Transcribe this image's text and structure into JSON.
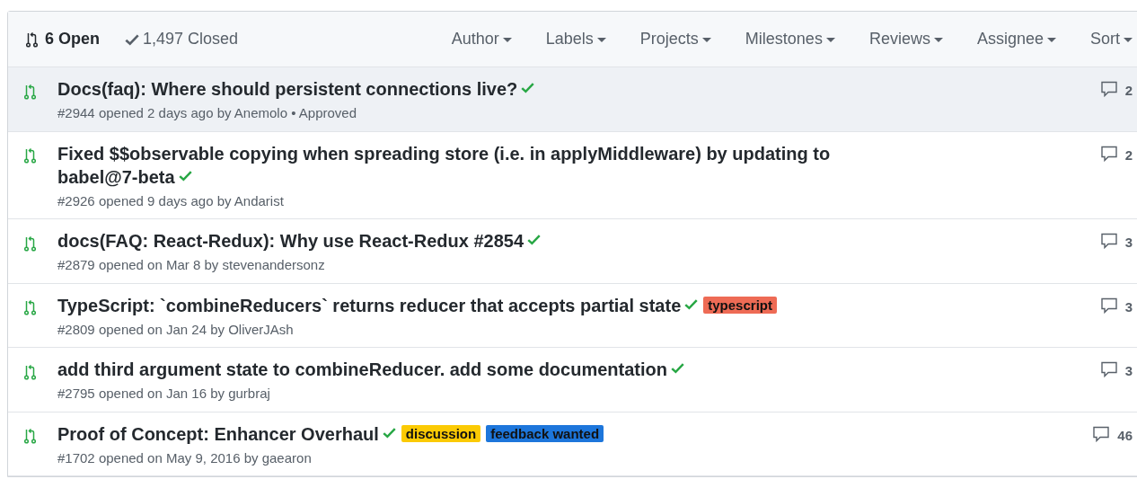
{
  "header": {
    "open": "6 Open",
    "closed": "1,497 Closed",
    "filters": [
      "Author",
      "Labels",
      "Projects",
      "Milestones",
      "Reviews",
      "Assignee",
      "Sort"
    ]
  },
  "pulls": [
    {
      "title": "Docs(faq): Where should persistent connections live?",
      "checks_passed": true,
      "selected": true,
      "meta": "#2944 opened 2 days ago by Anemolo • Approved",
      "comments": "2"
    },
    {
      "title": "Fixed $$observable copying when spreading store (i.e. in applyMiddleware) by updating to babel@7-beta",
      "checks_passed": true,
      "selected": false,
      "meta": "#2926 opened 9 days ago by Andarist",
      "comments": "2"
    },
    {
      "title": "docs(FAQ: React-Redux): Why use React-Redux #2854",
      "checks_passed": true,
      "selected": false,
      "meta": "#2879 opened on Mar 8 by stevenandersonz",
      "comments": "3"
    },
    {
      "title": "TypeScript: `combineReducers` returns reducer that accepts partial state",
      "checks_passed": true,
      "selected": false,
      "labels": [
        {
          "name": "typescript",
          "color": "#ee6b55"
        }
      ],
      "meta": "#2809 opened on Jan 24 by OliverJAsh",
      "comments": "3"
    },
    {
      "title": "add third argument state to combineReducer. add some documentation",
      "checks_passed": true,
      "selected": false,
      "meta": "#2795 opened on Jan 16 by gurbraj",
      "comments": "3"
    },
    {
      "title": "Proof of Concept: Enhancer Overhaul",
      "checks_passed": true,
      "selected": false,
      "labels": [
        {
          "name": "discussion",
          "color": "#fbca04"
        },
        {
          "name": "feedback wanted",
          "color": "#1d76db"
        }
      ],
      "meta": "#1702 opened on May 9, 2016 by gaearon",
      "comments": "46"
    }
  ]
}
